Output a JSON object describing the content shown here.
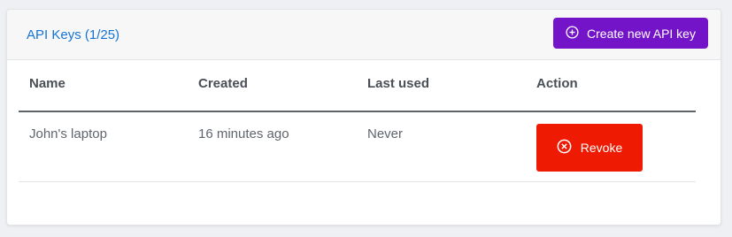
{
  "header": {
    "title": "API Keys (1/25)",
    "create_button_label": "Create new API key",
    "create_button_icon": "plus-circle-icon"
  },
  "table": {
    "columns": [
      "Name",
      "Created",
      "Last used",
      "Action"
    ],
    "rows": [
      {
        "name": "John's laptop",
        "created": "16 minutes ago",
        "last_used": "Never",
        "action_label": "Revoke",
        "action_icon": "x-circle-icon"
      }
    ]
  },
  "colors": {
    "title": "#1574d4",
    "create_button": "#7414c9",
    "revoke_button": "#ee1a02"
  }
}
